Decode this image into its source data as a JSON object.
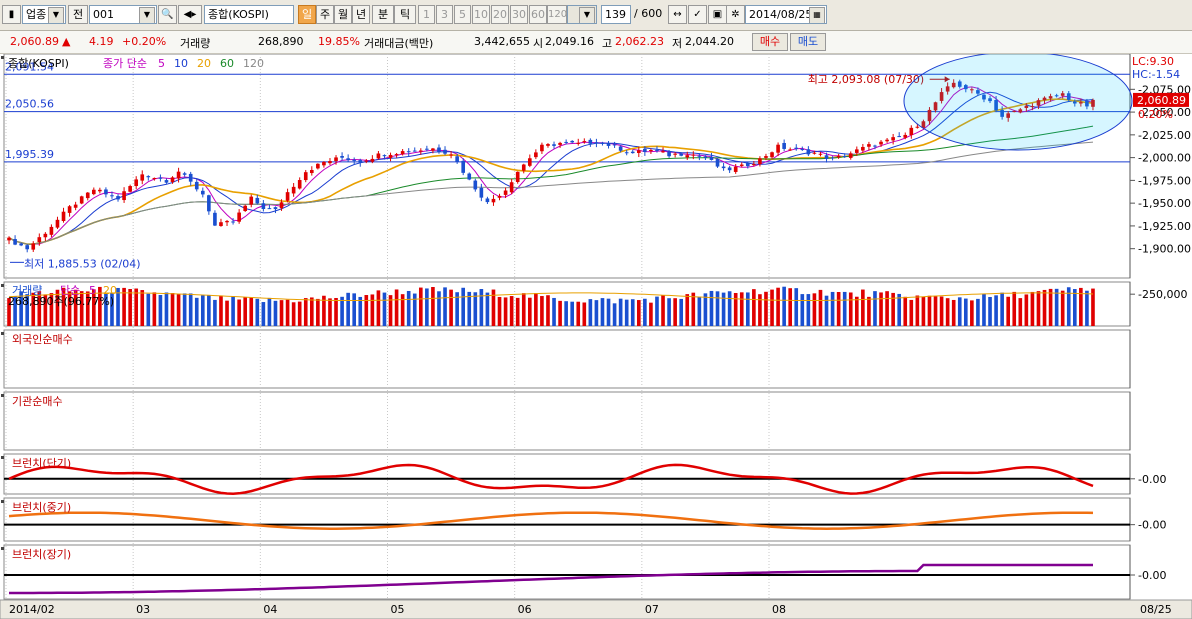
{
  "toolbar": {
    "market": "업종",
    "prefix": "전",
    "code": "001",
    "name": "종합(KOSPI)",
    "periods": [
      "일",
      "주",
      "월",
      "년",
      "분",
      "틱"
    ],
    "active_period": "일",
    "minutes": [
      "1",
      "3",
      "5",
      "10",
      "20",
      "30",
      "60",
      "120"
    ],
    "count": "139",
    "count_total": "/ 600",
    "date": "2014/08/25"
  },
  "quote": {
    "price": "2,060.89",
    "arrow": "▲",
    "change": "4.19",
    "change_pct": "+0.20%",
    "volume_label": "거래량",
    "volume": "268,890",
    "volume_pct": "19.85%",
    "amount_label": "거래대금(백만)",
    "amount": "3,442,655",
    "open_label": "시",
    "open": "2,049.16",
    "high_label": "고",
    "high": "2,062.23",
    "low_label": "저",
    "low": "2,044.20",
    "buy_label": "매수",
    "sell_label": "매도"
  },
  "colors": {
    "up": "#e00000",
    "down": "#1a4fd0",
    "ma5": "#c000c0",
    "ma10": "#1a3dd0",
    "ma20": "#e8a000",
    "ma60": "#1a8a2a",
    "ma120": "#888888"
  },
  "chart_data": [
    {
      "type": "candlestick",
      "title": "종합(KOSPI)",
      "legend": {
        "label": "종가 단순",
        "periods": [
          "5",
          "10",
          "20",
          "60",
          "120"
        ]
      },
      "ylim": [
        1870,
        2105
      ],
      "yticks": [
        "2,075.00",
        "2,050.00",
        "2,025.00",
        "2,000.00",
        "1,975.00",
        "1,950.00",
        "1,925.00",
        "1,900.00"
      ],
      "ytick_values": [
        2075,
        2050,
        2025,
        2000,
        1975,
        1950,
        1925,
        1900
      ],
      "hlines": [
        {
          "value": 2091.54,
          "label": "2,091.54"
        },
        {
          "value": 2050.56,
          "label": "2,050.56"
        },
        {
          "value": 1995.39,
          "label": "1,995.39"
        }
      ],
      "lc": "LC:9.30",
      "hc": "HC:-1.54",
      "last_price": "2,060.89",
      "last_pct": "0.20%",
      "max_label": "최고 2,093.08 (07/30)",
      "min_label": "최저 1,885.53 (02/04)",
      "anchors": [
        [
          0,
          1910
        ],
        [
          3,
          1900
        ],
        [
          6,
          1918
        ],
        [
          10,
          1945
        ],
        [
          14,
          1965
        ],
        [
          18,
          1955
        ],
        [
          22,
          1982
        ],
        [
          26,
          1975
        ],
        [
          28,
          1985
        ],
        [
          32,
          1960
        ],
        [
          34,
          1925
        ],
        [
          37,
          1930
        ],
        [
          40,
          1955
        ],
        [
          42,
          1945
        ],
        [
          44,
          1942
        ],
        [
          46,
          1962
        ],
        [
          49,
          1985
        ],
        [
          52,
          1995
        ],
        [
          55,
          2000
        ],
        [
          58,
          1996
        ],
        [
          61,
          2003
        ],
        [
          64,
          2006
        ],
        [
          67,
          2008
        ],
        [
          70,
          2010
        ],
        [
          73,
          2005
        ],
        [
          76,
          1975
        ],
        [
          79,
          1950
        ],
        [
          82,
          1965
        ],
        [
          84,
          1985
        ],
        [
          86,
          2000
        ],
        [
          88,
          2012
        ],
        [
          91,
          2016
        ],
        [
          94,
          2015
        ],
        [
          97,
          2018
        ],
        [
          100,
          2012
        ],
        [
          103,
          2005
        ],
        [
          106,
          2008
        ],
        [
          109,
          2003
        ],
        [
          112,
          2005
        ],
        [
          115,
          2000
        ],
        [
          118,
          1986
        ],
        [
          121,
          1990
        ],
        [
          124,
          1998
        ],
        [
          127,
          2012
        ],
        [
          130,
          2008
        ],
        [
          133,
          2005
        ],
        [
          136,
          1998
        ],
        [
          139,
          2005
        ],
        [
          142,
          2013
        ],
        [
          145,
          2018
        ],
        [
          148,
          2025
        ],
        [
          151,
          2042
        ],
        [
          154,
          2070
        ],
        [
          156,
          2082
        ],
        [
          158,
          2076
        ],
        [
          160,
          2070
        ],
        [
          162,
          2062
        ],
        [
          164,
          2045
        ],
        [
          166,
          2050
        ],
        [
          168,
          2056
        ],
        [
          170,
          2062
        ],
        [
          172,
          2066
        ],
        [
          174,
          2070
        ],
        [
          176,
          2060
        ],
        [
          178,
          2057
        ],
        [
          179,
          2061
        ]
      ]
    },
    {
      "type": "bar",
      "title": "거래량",
      "legend": {
        "label": "단순",
        "periods": [
          "5",
          "20"
        ]
      },
      "value_label": "268,890주(96.77%)",
      "ytick": "250,000",
      "ytick_value": 250000,
      "ylim": [
        0,
        330000
      ]
    },
    {
      "type": "line",
      "title": "외국인순매수"
    },
    {
      "type": "line",
      "title": "기관순매수"
    },
    {
      "type": "line",
      "title": "브런치(단기)",
      "ytick": "0.00",
      "color": "#e00000"
    },
    {
      "type": "line",
      "title": "브런치(중기)",
      "ytick": "0.00",
      "color": "#f07010"
    },
    {
      "type": "line",
      "title": "브런치(장기)",
      "ytick": "0.00",
      "color": "#800090"
    }
  ],
  "xaxis": {
    "labels": [
      "2014/02",
      "03",
      "04",
      "05",
      "06",
      "07",
      "08"
    ],
    "label_index": [
      0,
      21,
      42,
      63,
      84,
      105,
      126
    ],
    "end_label": "08/25"
  }
}
